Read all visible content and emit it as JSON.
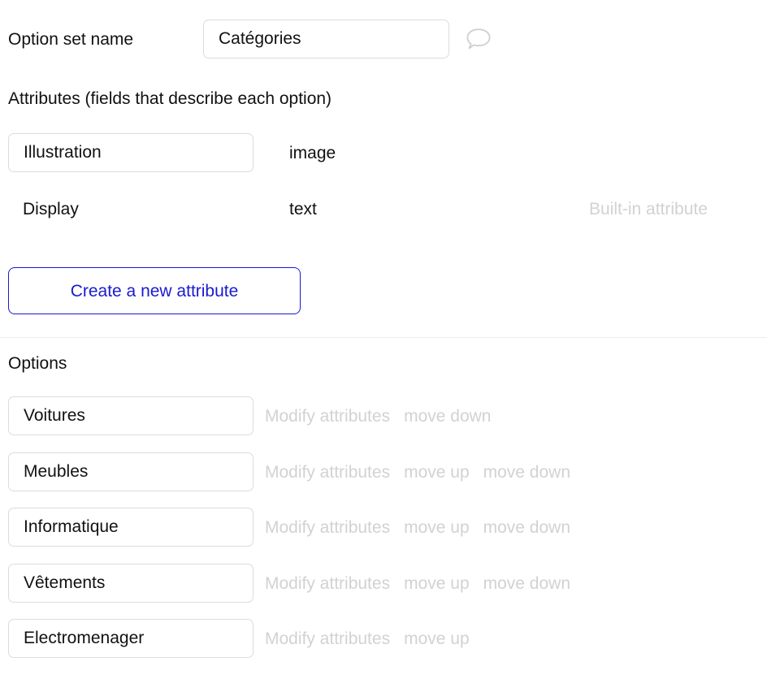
{
  "name_row": {
    "label": "Option set name",
    "value": "Catégories",
    "placeholder": "",
    "comment_icon": "speech-bubble-icon"
  },
  "attributes_section": {
    "heading": "Attributes (fields that describe each option)",
    "rows": [
      {
        "name": "Illustration",
        "type": "image",
        "note": "",
        "editable": true
      },
      {
        "name": "Display",
        "type": "text",
        "note": "Built-in attribute",
        "editable": false
      }
    ],
    "create_button": "Create a new attribute"
  },
  "options_section": {
    "heading": "Options",
    "action_labels": {
      "modify": "Modify attributes",
      "move_up": "move up",
      "move_down": "move down"
    },
    "rows": [
      {
        "value": "Voitures",
        "modify": "Modify attributes",
        "move_up": "",
        "move_down": "move down"
      },
      {
        "value": "Meubles",
        "modify": "Modify attributes",
        "move_up": "move up",
        "move_down": "move down"
      },
      {
        "value": "Informatique",
        "modify": "Modify attributes",
        "move_up": "move up",
        "move_down": "move down"
      },
      {
        "value": "Vêtements",
        "modify": "Modify attributes",
        "move_up": "move up",
        "move_down": "move down"
      },
      {
        "value": "Electromenager",
        "modify": "Modify attributes",
        "move_up": "move up",
        "move_down": ""
      }
    ]
  },
  "colors": {
    "accent_blue": "#1a1ad0",
    "muted_gray": "#d2d2d4",
    "input_border": "#dcdce0",
    "divider": "#ececed",
    "text": "#111111"
  }
}
